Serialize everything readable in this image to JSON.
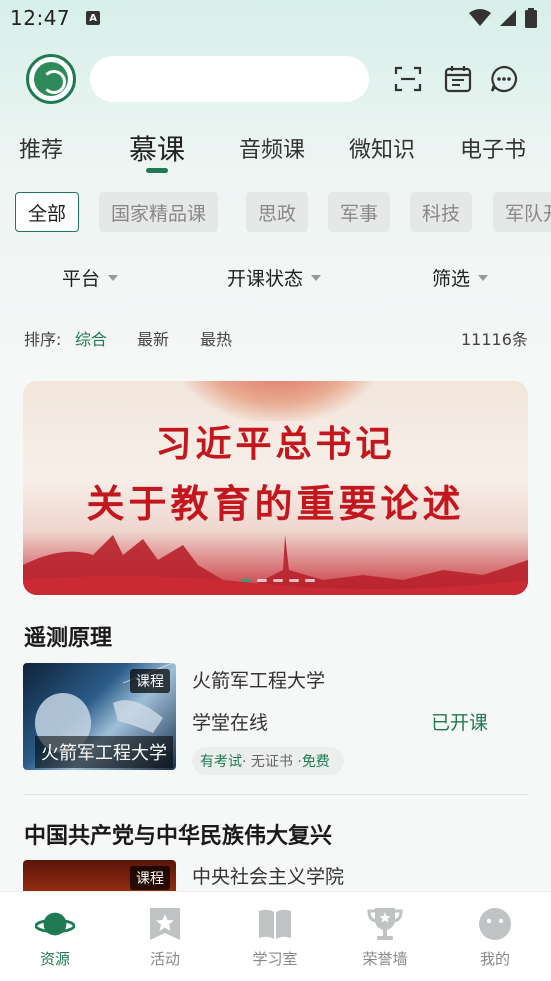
{
  "status_bar": {
    "time": "12:47",
    "notif_icon": "a-letter-icon"
  },
  "header": {
    "search_placeholder": "",
    "icons": [
      "scan-icon",
      "calendar-icon",
      "chat-icon"
    ]
  },
  "tabs": [
    {
      "label": "推荐"
    },
    {
      "label": "慕课",
      "active": true
    },
    {
      "label": "音频课"
    },
    {
      "label": "微知识"
    },
    {
      "label": "电子书"
    }
  ],
  "chips": [
    {
      "label": "全部",
      "active": true
    },
    {
      "label": "国家精品课"
    },
    {
      "label": "思政"
    },
    {
      "label": "军事"
    },
    {
      "label": "科技"
    },
    {
      "label": "军队开"
    }
  ],
  "filters": {
    "platform": "平台",
    "status": "开课状态",
    "filter": "筛选"
  },
  "sort": {
    "label": "排序:",
    "options": [
      "综合",
      "最新",
      "最热"
    ],
    "active": "综合",
    "count": "11116条"
  },
  "banner": {
    "line1": "习近平总书记",
    "line2": "关于教育的重要论述",
    "slide_count": 5,
    "active_slide": 1
  },
  "courses": [
    {
      "title": "遥测原理",
      "badge": "课程",
      "thumb_caption": "火箭军工程大学",
      "institution": "火箭军工程大学",
      "platform": "学堂在线",
      "status": "已开课",
      "exam": "有考试",
      "cert": "· 无证书 ·",
      "price": "免费"
    },
    {
      "title": "中国共产党与中华民族伟大复兴",
      "badge": "课程",
      "institution": "中央社会主义学院"
    }
  ],
  "bottom_nav": [
    {
      "label": "资源",
      "icon": "planet-icon",
      "active": true
    },
    {
      "label": "活动",
      "icon": "star-bookmark-icon"
    },
    {
      "label": "学习室",
      "icon": "book-icon"
    },
    {
      "label": "荣誉墙",
      "icon": "trophy-icon"
    },
    {
      "label": "我的",
      "icon": "profile-face-icon"
    }
  ],
  "colors": {
    "accent": "#1f7a53",
    "banner_red": "#c3161d"
  }
}
